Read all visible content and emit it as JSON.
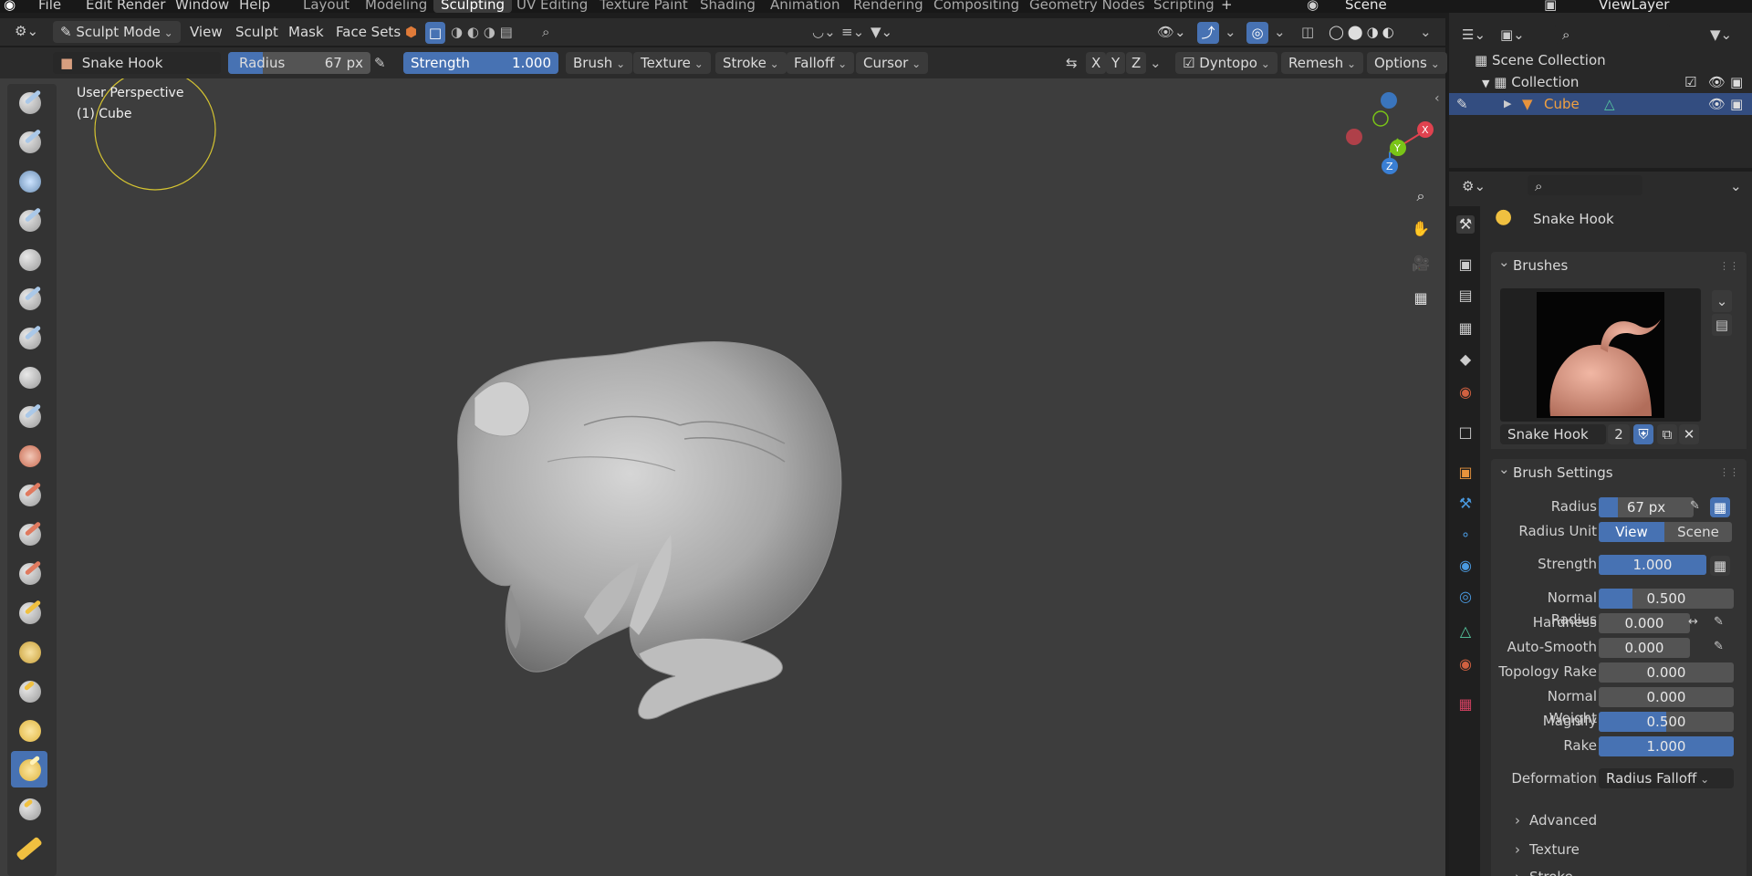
{
  "topbar": {
    "menus": [
      "File",
      "Edit",
      "Render",
      "Window",
      "Help"
    ],
    "workspaces": [
      "Layout",
      "Modeling",
      "Sculpting",
      "UV Editing",
      "Texture Paint",
      "Shading",
      "Animation",
      "Rendering",
      "Compositing",
      "Geometry Nodes",
      "Scripting"
    ],
    "active_workspace": "Sculpting",
    "scene": "Scene",
    "view_layer": "ViewLayer"
  },
  "header": {
    "mode": "Sculpt Mode",
    "menus": [
      "View",
      "Sculpt",
      "Mask",
      "Face Sets"
    ]
  },
  "toolheader": {
    "brush_name": "Snake Hook",
    "radius_label": "Radius",
    "radius_value": "67 px",
    "strength_label": "Strength",
    "strength_value": "1.000",
    "dropdowns": [
      "Brush",
      "Texture",
      "Stroke",
      "Falloff",
      "Cursor"
    ],
    "axes": [
      "X",
      "Y",
      "Z"
    ],
    "dyntopo": "Dyntopo",
    "remesh": "Remesh",
    "options": "Options"
  },
  "viewport": {
    "perspective": "User Perspective",
    "object": "(1) Cube",
    "gizmo_axes": [
      "X",
      "Y",
      "Z"
    ],
    "colors": {
      "x": "#e0424f",
      "y": "#7ac417",
      "z": "#3a7fd4",
      "cursor": "#d6c531",
      "mesh": "#b9b9b9"
    }
  },
  "outliner": {
    "items": [
      {
        "label": "Scene Collection"
      },
      {
        "label": "Collection"
      },
      {
        "label": "Cube"
      }
    ]
  },
  "properties": {
    "brush_title": "Snake Hook",
    "brushes_panel": "Brushes",
    "brush_slot_name": "Snake Hook",
    "brush_users": "2",
    "brush_settings_panel": "Brush Settings",
    "settings": [
      {
        "label": "Radius",
        "value": "67 px",
        "fill": 0.2
      },
      {
        "label": "Radius Unit",
        "value": ""
      },
      {
        "label": "Strength",
        "value": "1.000",
        "fill": 1.0
      },
      {
        "label": "Normal Radius",
        "value": "0.500",
        "fill": 0.25
      },
      {
        "label": "Hardness",
        "value": "0.000",
        "fill": 0
      },
      {
        "label": "Auto-Smooth",
        "value": "0.000",
        "fill": 0
      },
      {
        "label": "Topology Rake",
        "value": "0.000",
        "fill": 0
      },
      {
        "label": "Normal Weight",
        "value": "0.000",
        "fill": 0
      },
      {
        "label": "Magnify",
        "value": "0.500",
        "fill": 0.5
      },
      {
        "label": "Rake",
        "value": "1.000",
        "fill": 1.0
      }
    ],
    "radius_unit_options": [
      "View",
      "Scene"
    ],
    "deformation_label": "Deformation",
    "deformation_value": "Radius Falloff",
    "subpanels": [
      "Advanced",
      "Texture",
      "Stroke"
    ]
  }
}
